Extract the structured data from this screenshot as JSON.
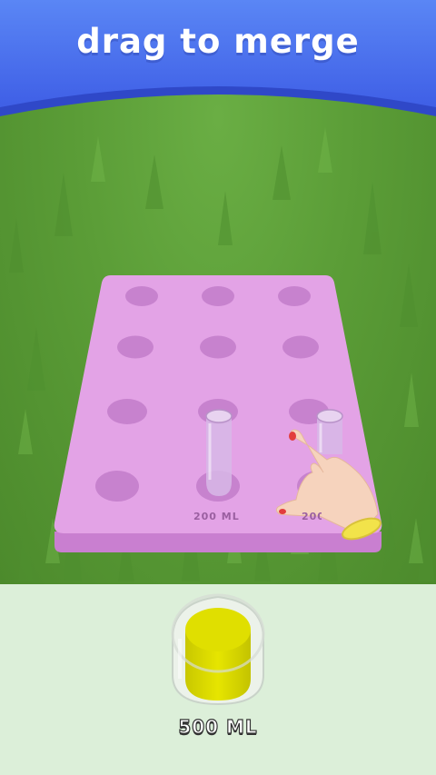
{
  "header": {
    "title": "drag to merge"
  },
  "board": {
    "tubes": [
      {
        "label": "200 ML"
      },
      {
        "label": "200 ML"
      }
    ]
  },
  "target_cup": {
    "label": "500 ML"
  },
  "colors": {
    "header_blue": "#4a72ef",
    "grass_green": "#5b9d37",
    "board_pink": "#e3a3e6",
    "liquid_yellow": "#e3e200",
    "panel_mint": "#dcefd9"
  },
  "icons": {
    "hand": "pointing-hand-icon"
  }
}
